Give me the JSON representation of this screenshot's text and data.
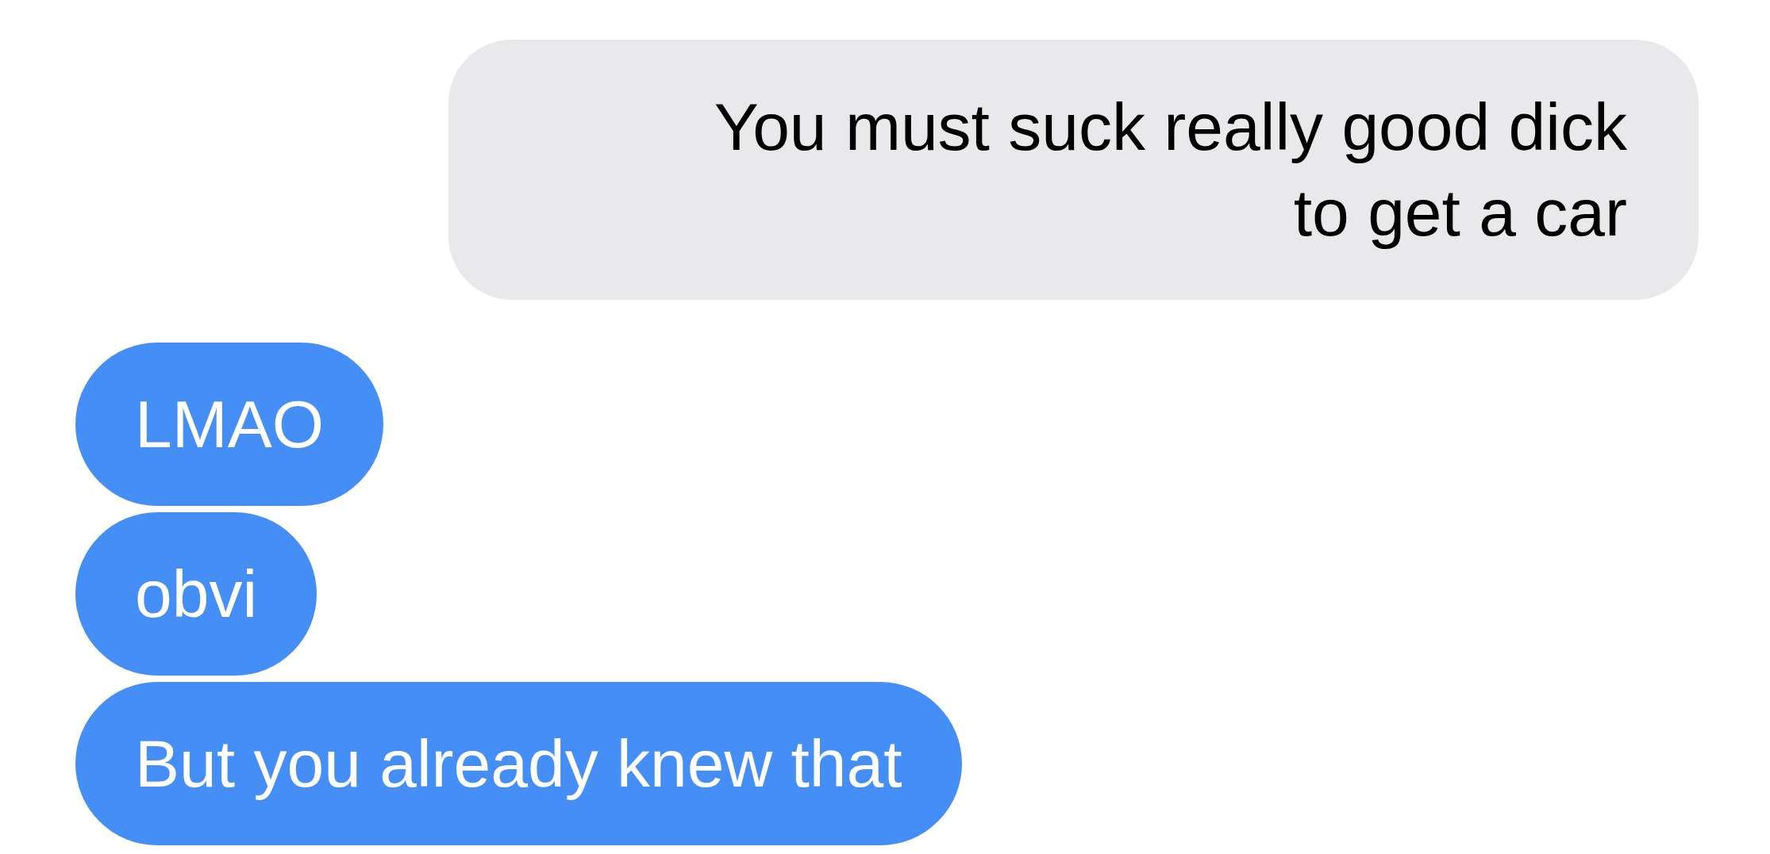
{
  "messages": [
    {
      "kind": "incoming",
      "text": "You must suck really good dick to get a car"
    },
    {
      "kind": "outgoing",
      "text": "LMAO"
    },
    {
      "kind": "outgoing",
      "text": "obvi"
    },
    {
      "kind": "outgoing",
      "text": "But you already knew that"
    }
  ]
}
